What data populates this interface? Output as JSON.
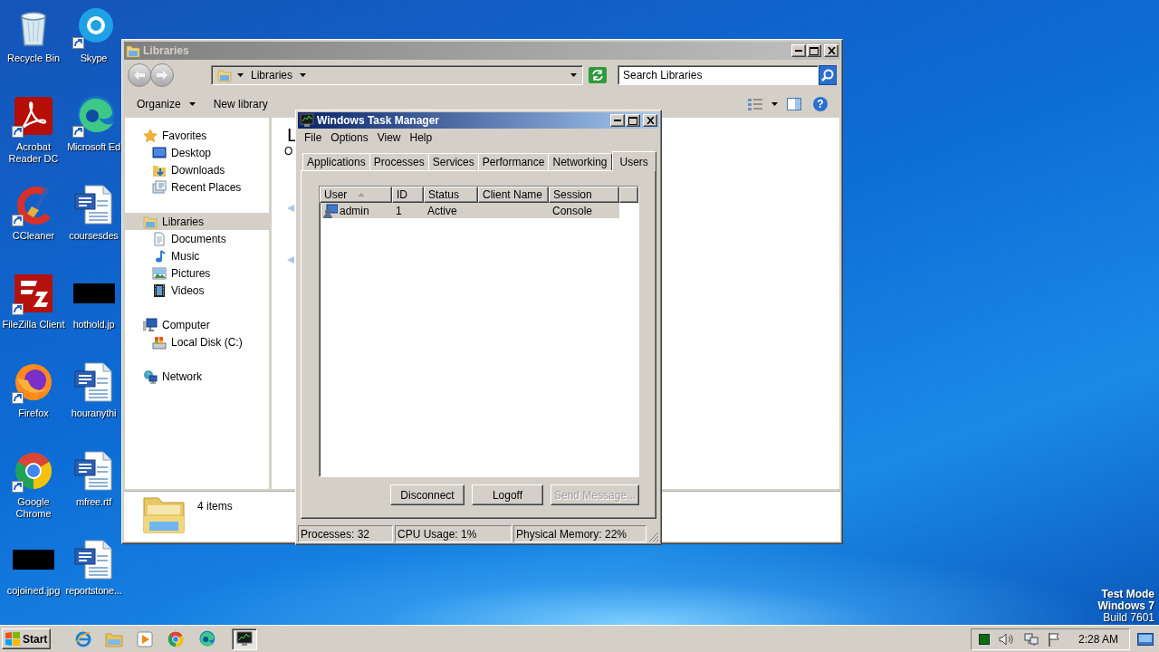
{
  "desktop": {
    "icons": [
      {
        "label": "Recycle Bin",
        "kind": "recycle",
        "shortcut": false
      },
      {
        "label": "Skype",
        "kind": "skype",
        "shortcut": true
      },
      {
        "label": "Acrobat Reader DC",
        "kind": "acrobat",
        "shortcut": true
      },
      {
        "label": "Microsoft Ed",
        "kind": "edge",
        "shortcut": true
      },
      {
        "label": "CCleaner",
        "kind": "ccleaner",
        "shortcut": true
      },
      {
        "label": "coursesdes",
        "kind": "word",
        "shortcut": false
      },
      {
        "label": "FileZilla Client",
        "kind": "filezilla",
        "shortcut": true
      },
      {
        "label": "hothold.jp",
        "kind": "thumb",
        "shortcut": false
      },
      {
        "label": "Firefox",
        "kind": "firefox",
        "shortcut": true
      },
      {
        "label": "houranythi",
        "kind": "word",
        "shortcut": false
      },
      {
        "label": "Google Chrome",
        "kind": "chrome",
        "shortcut": true
      },
      {
        "label": "mfree.rtf",
        "kind": "word",
        "shortcut": false
      },
      {
        "label": "cojoined.jpg",
        "kind": "thumb",
        "shortcut": false
      },
      {
        "label": "reportstone...",
        "kind": "word",
        "shortcut": false
      }
    ],
    "system_info": [
      {
        "text": "Test Mode",
        "bold": true
      },
      {
        "text": "Windows 7",
        "bold": true
      },
      {
        "text": "Build 7601",
        "bold": false
      }
    ]
  },
  "explorer": {
    "title": "Libraries",
    "address": "Libraries",
    "search": {
      "placeholder": "Search Libraries"
    },
    "toolbar": [
      {
        "label": "Organize",
        "dropdown": true
      },
      {
        "label": "New library",
        "dropdown": false
      }
    ],
    "help": "?",
    "navigation": [
      {
        "label": "Favorites",
        "kind": "star",
        "selected": false,
        "children": [
          {
            "label": "Desktop",
            "kind": "desktop",
            "selected": false
          },
          {
            "label": "Downloads",
            "kind": "downloads",
            "selected": false
          },
          {
            "label": "Recent Places",
            "kind": "recent",
            "selected": false
          }
        ]
      },
      {
        "label": "Libraries",
        "kind": "library",
        "selected": true,
        "children": [
          {
            "label": "Documents",
            "kind": "documents",
            "selected": false
          },
          {
            "label": "Music",
            "kind": "music",
            "selected": false
          },
          {
            "label": "Pictures",
            "kind": "pictures",
            "selected": false
          },
          {
            "label": "Videos",
            "kind": "videos",
            "selected": false
          }
        ]
      },
      {
        "label": "Computer",
        "kind": "computer",
        "selected": false,
        "children": [
          {
            "label": "Local Disk (C:)",
            "kind": "disk",
            "selected": false
          }
        ]
      },
      {
        "label": "Network",
        "kind": "network",
        "selected": false
      }
    ],
    "content": {
      "title": "L",
      "subtitle": "O"
    },
    "details": {
      "count": "4 items"
    }
  },
  "task_manager": {
    "title": "Windows Task Manager",
    "menu": [
      "File",
      "Options",
      "View",
      "Help"
    ],
    "tabs": [
      {
        "label": "Applications",
        "selected": false
      },
      {
        "label": "Processes",
        "selected": false
      },
      {
        "label": "Services",
        "selected": false
      },
      {
        "label": "Performance",
        "selected": false
      },
      {
        "label": "Networking",
        "selected": false
      },
      {
        "label": "Users",
        "selected": true
      }
    ],
    "columns": [
      {
        "label": "User",
        "sorted": true
      },
      {
        "label": "ID",
        "sorted": false
      },
      {
        "label": "Status",
        "sorted": false
      },
      {
        "label": "Client Name",
        "sorted": false
      },
      {
        "label": "Session",
        "sorted": false
      }
    ],
    "rows": [
      {
        "user": "admin",
        "id": "1",
        "status": "Active",
        "session": "Console",
        "selected": true
      }
    ],
    "buttons": [
      {
        "label": "Disconnect",
        "disabled": false
      },
      {
        "label": "Logoff",
        "disabled": false
      },
      {
        "label": "Send Message...",
        "disabled": true
      }
    ],
    "status_bar": [
      "Processes: 32",
      "CPU Usage: 1%",
      "Physical Memory: 22%"
    ]
  },
  "taskbar": {
    "start": "Start",
    "apps": [
      {
        "kind": "ie",
        "active": false
      },
      {
        "kind": "folder",
        "active": false
      },
      {
        "kind": "media",
        "active": false
      },
      {
        "kind": "chrome",
        "active": false
      },
      {
        "kind": "edge",
        "active": false
      },
      {
        "kind": "taskmgr",
        "active": true
      }
    ],
    "clock": "2:28 AM"
  }
}
